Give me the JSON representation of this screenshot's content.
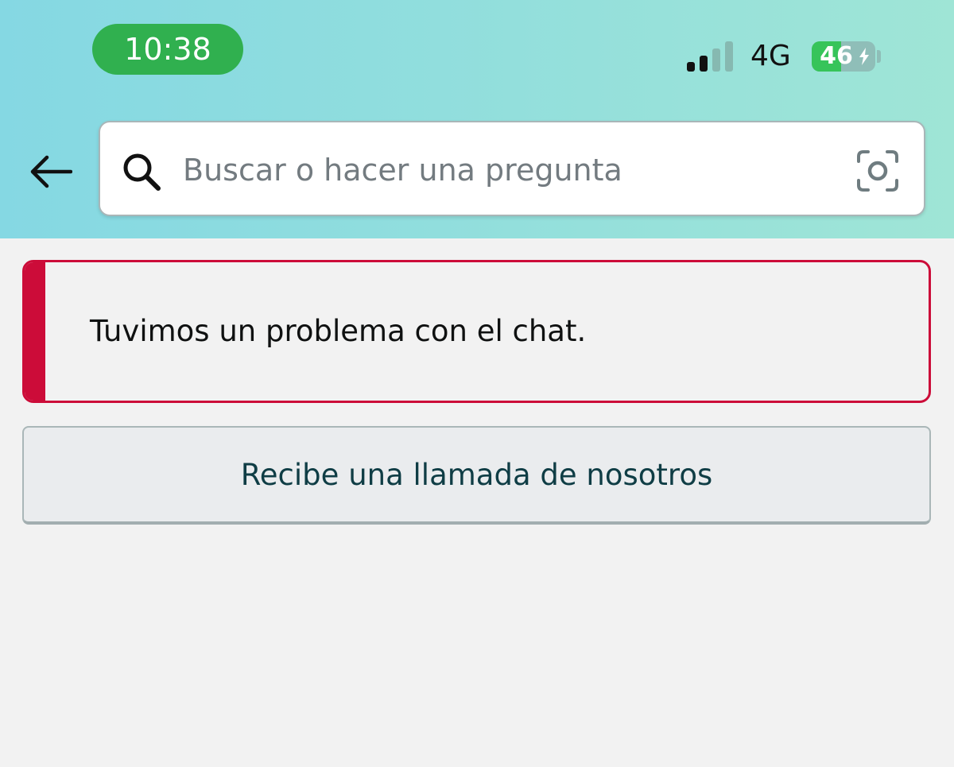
{
  "status_bar": {
    "time": "10:38",
    "network": "4G",
    "battery_level": "46",
    "battery_fraction": 0.46,
    "signal_bars_filled": 2,
    "signal_bars_total": 4,
    "time_pill_color": "#30b04f"
  },
  "header": {
    "back_icon": "arrow-left-icon",
    "search": {
      "placeholder": "Buscar o hacer una pregunta",
      "value": "",
      "search_icon": "magnifier-icon",
      "camera_icon": "camera-lens-icon"
    }
  },
  "alert": {
    "message": "Tuvimos un problema con el chat.",
    "accent_color": "#cc0c39"
  },
  "actions": {
    "call_label": "Recibe una llamada de nosotros"
  }
}
